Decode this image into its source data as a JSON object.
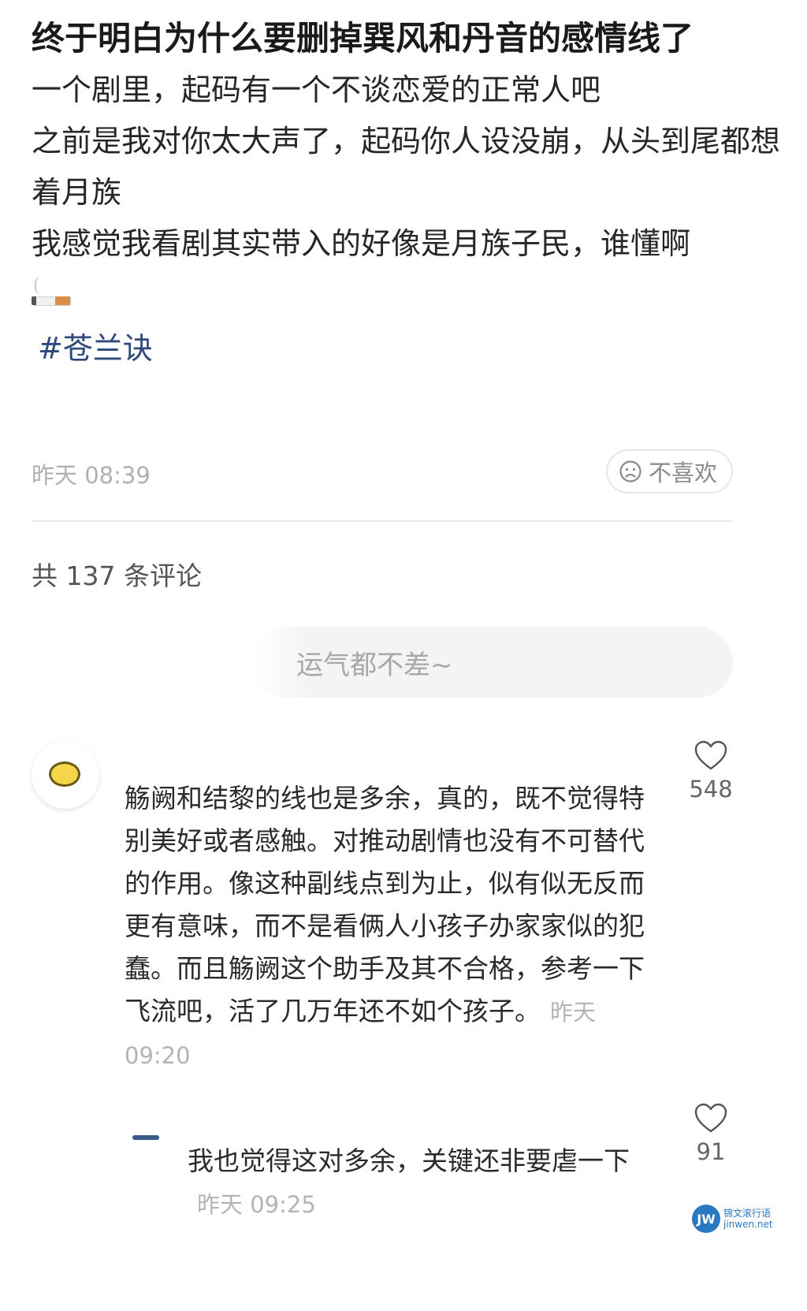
{
  "post": {
    "title": "终于明白为什么要删掉巽风和丹音的感情线了",
    "lines": [
      "一个剧里，起码有一个不谈恋爱的正常人吧",
      "之前是我对你太大声了，起码你人设没崩，从头到尾都想着月族",
      "我感觉我看剧其实带入的好像是月族子民，谁懂啊"
    ],
    "emoji": "cigarette",
    "hashtag": "#苍兰诀",
    "time": "昨天 08:39",
    "dislike_label": "不喜欢"
  },
  "comments_header": {
    "count_text": "共 137 条评论"
  },
  "comment_input": {
    "placeholder": "运气都不差~"
  },
  "comments": [
    {
      "text": "觞阙和结黎的线也是多余，真的，既不觉得特别美好或者感触。对推动剧情也没有不可替代的作用。像这种副线点到为止，似有似无反而更有意味，而不是看俩人小孩子办家家似的犯蠢。而且觞阙这个助手及其不合格，参考一下飞流吧，活了几万年还不如个孩子。",
      "time": "昨天 09:20",
      "likes": "548"
    },
    {
      "text": "我也觉得这对多余，关键还非要虐一下",
      "time": "昨天 09:25",
      "likes": "91"
    }
  ],
  "watermark": {
    "logo_text": "JW",
    "name": "锦文滚行语",
    "site": "jinwen.net"
  },
  "colors": {
    "hashtag": "#2d4a7a",
    "meta_gray": "#b0b0b0",
    "watermark": "#2b78c2"
  }
}
